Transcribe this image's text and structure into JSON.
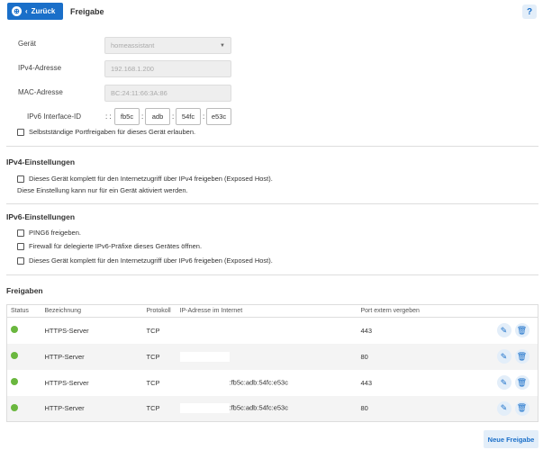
{
  "header": {
    "back_label": "Zurück",
    "title": "Freigabe",
    "help": "?"
  },
  "device": {
    "geraet_label": "Gerät",
    "geraet_value": "homeassistant",
    "ipv4_label": "IPv4-Adresse",
    "ipv4_value": "192.168.1.200",
    "mac_label": "MAC-Adresse",
    "mac_value": "BC:24:11:66:3A:86",
    "ipv6_label": "IPv6 Interface-ID",
    "ipv6_prefix": ": :",
    "ipv6_parts": [
      "fb5c",
      "adb",
      "54fc",
      "e53c"
    ],
    "self_port_label": "Selbstständige Portfreigaben für dieses Gerät erlauben."
  },
  "ipv4": {
    "heading": "IPv4-Einstellungen",
    "exposed_label": "Dieses Gerät komplett für den Internetzugriff über IPv4 freigeben (Exposed Host).",
    "note": "Diese Einstellung kann nur für ein Gerät aktiviert werden."
  },
  "ipv6": {
    "heading": "IPv6-Einstellungen",
    "options": [
      "PING6 freigeben.",
      "Firewall für delegierte IPv6-Präfixe dieses Gerätes öffnen.",
      "Dieses Gerät komplett für den Internetzugriff über IPv6 freigeben (Exposed Host)."
    ]
  },
  "freigaben": {
    "heading": "Freigaben",
    "columns": [
      "Status",
      "Bezeichnung",
      "Protokoll",
      "IP-Adresse im Internet",
      "Port extern vergeben"
    ],
    "rows": [
      {
        "name": "HTTPS-Server",
        "proto": "TCP",
        "ip": "",
        "port": "443"
      },
      {
        "name": "HTTP-Server",
        "proto": "TCP",
        "ip": "",
        "port": "80"
      },
      {
        "name": "HTTPS-Server",
        "proto": "TCP",
        "ip": ":fb5c:adb:54fc:e53c",
        "port": "443"
      },
      {
        "name": "HTTP-Server",
        "proto": "TCP",
        "ip": ":fb5c:adb:54fc:e53c",
        "port": "80"
      }
    ],
    "status_color": "#6ab73e",
    "new_button": "Neue Freigabe"
  },
  "accent": "#1a6fc9"
}
